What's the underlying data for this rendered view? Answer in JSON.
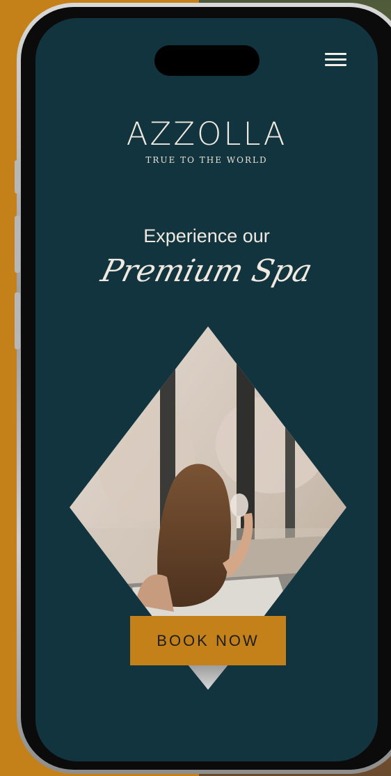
{
  "brand": {
    "name": "AZZOLLA",
    "tagline": "TRUE TO THE WORLD"
  },
  "hero": {
    "line1": "Experience our",
    "line2": "Premium Spa"
  },
  "cta": {
    "label": "BOOK NOW"
  },
  "colors": {
    "background_orange": "#c4811a",
    "screen_teal": "#12343f",
    "cream_text": "#efe9df",
    "button_orange": "#c4811a"
  },
  "icons": {
    "menu": "hamburger-menu-icon"
  }
}
